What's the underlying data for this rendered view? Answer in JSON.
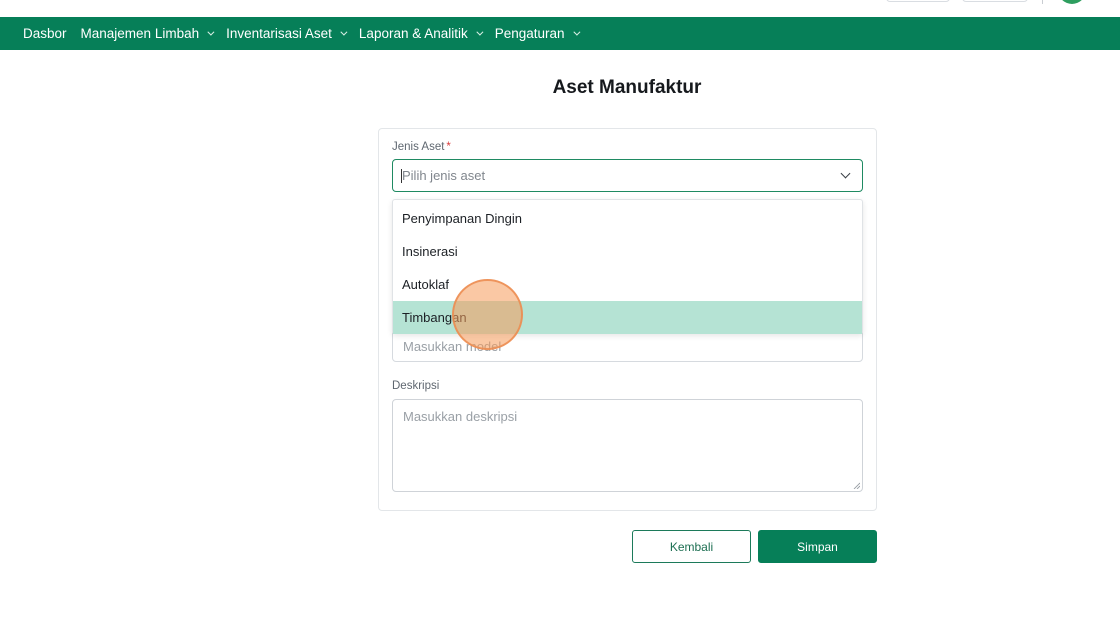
{
  "nav": {
    "items": [
      {
        "label": "Dasbor",
        "has_menu": false
      },
      {
        "label": "Manajemen Limbah",
        "has_menu": true
      },
      {
        "label": "Inventarisasi Aset",
        "has_menu": true
      },
      {
        "label": "Laporan & Analitik",
        "has_menu": true
      },
      {
        "label": "Pengaturan",
        "has_menu": true
      }
    ]
  },
  "page": {
    "title": "Aset Manufaktur"
  },
  "form": {
    "asset_type": {
      "label": "Jenis Aset",
      "required_mark": "*",
      "placeholder": "Pilih jenis aset",
      "options": [
        "Penyimpanan Dingin",
        "Insinerasi",
        "Autoklaf",
        "Timbangan"
      ],
      "highlighted_option": "Timbangan"
    },
    "model": {
      "placeholder": "Masukkan model"
    },
    "description": {
      "label": "Deskripsi",
      "placeholder": "Masukkan deskripsi"
    }
  },
  "actions": {
    "back_label": "Kembali",
    "save_label": "Simpan"
  },
  "colors": {
    "primary": "#067f58",
    "option_highlight": "#b5e3d4",
    "required": "#d93b3b"
  }
}
